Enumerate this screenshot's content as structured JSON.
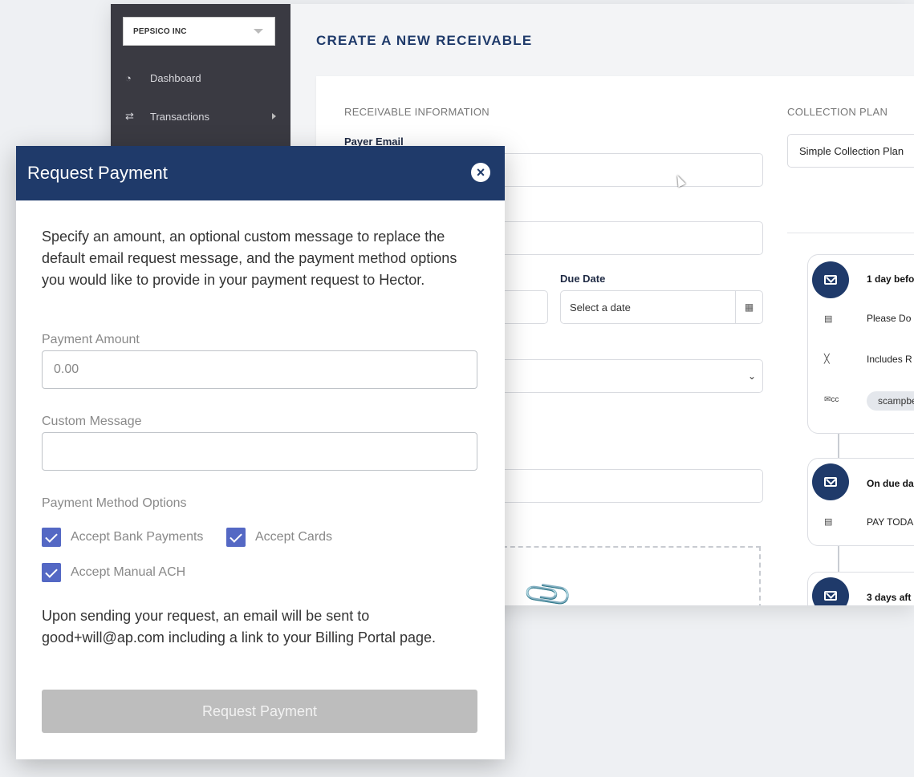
{
  "sidebar": {
    "company": "PEPSICO INC",
    "items": [
      {
        "label": "Dashboard",
        "icon": "dashboard-icon"
      },
      {
        "label": "Transactions",
        "icon": "transfer-icon"
      }
    ]
  },
  "page": {
    "title": "CREATE A NEW RECEIVABLE",
    "receivable_section": "RECEIVABLE INFORMATION",
    "payer_email_label": "Payer Email",
    "due_date_label": "Due Date",
    "due_date_placeholder": "Select a date",
    "collection_section": "COLLECTION PLAN",
    "collection_plan": "Simple Collection Plan"
  },
  "timeline": [
    {
      "title": "1 day befo",
      "rows": [
        {
          "icon": "document-icon",
          "text": "Please Do"
        },
        {
          "icon": "paperclip-icon",
          "text": "Includes R"
        }
      ],
      "cc": "scampbe"
    },
    {
      "title": "On due da",
      "rows": [
        {
          "icon": "document-icon",
          "text": "PAY TODA"
        }
      ]
    },
    {
      "title": "3 days aft"
    }
  ],
  "modal": {
    "title": "Request Payment",
    "description": "Specify an amount, an optional custom message to replace the default email request message, and the payment method options you would like to provide in your payment request to Hector.",
    "amount_label": "Payment Amount",
    "amount_placeholder": "0.00",
    "message_label": "Custom Message",
    "message_placeholder": "",
    "methods_label": "Payment Method Options",
    "methods": [
      {
        "label": "Accept Bank Payments",
        "checked": true
      },
      {
        "label": "Accept Cards",
        "checked": true
      },
      {
        "label": "Accept Manual ACH",
        "checked": true
      }
    ],
    "note": "Upon sending your request, an email will be sent to good+will@ap.com including a link to your Billing Portal page.",
    "submit_label": "Request Payment"
  },
  "colors": {
    "primary": "#1f3a6a",
    "checkbox": "#5468c4",
    "sidebar": "#3a3a42",
    "disabled_button": "#bdbdbd"
  }
}
